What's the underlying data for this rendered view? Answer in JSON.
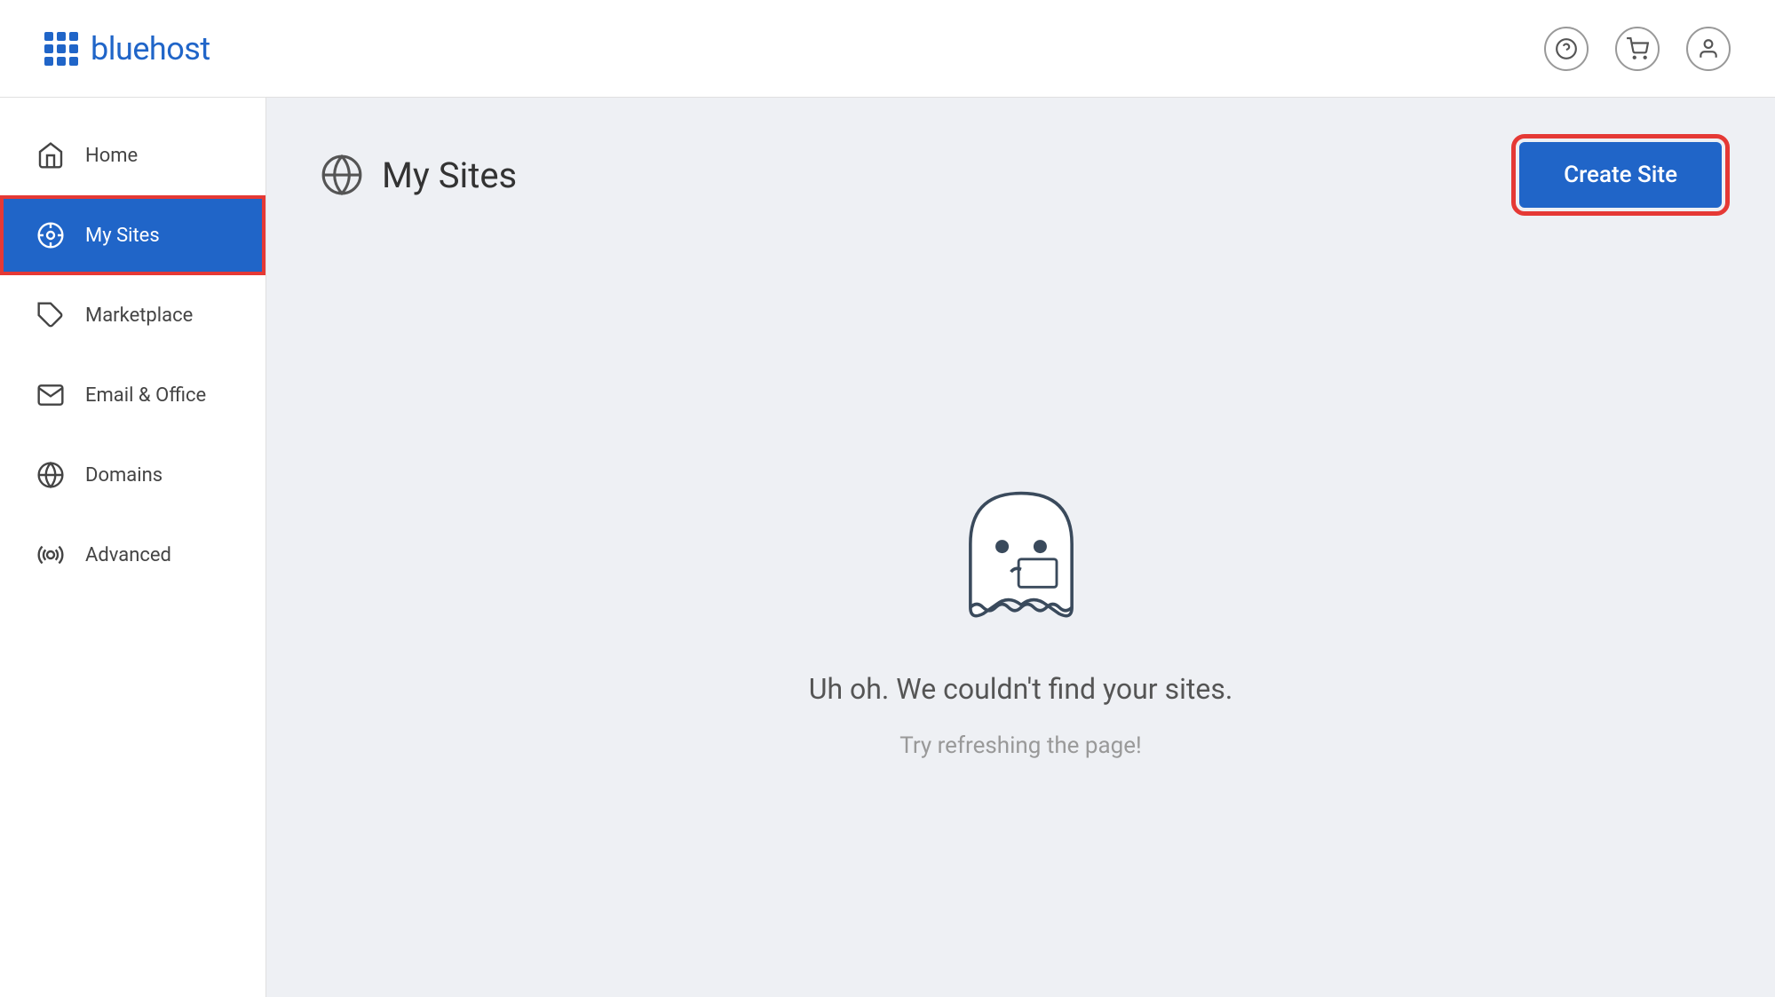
{
  "header": {
    "logo_text": "bluehost",
    "icons": {
      "help": "?",
      "cart": "🛒",
      "user": "👤"
    }
  },
  "sidebar": {
    "items": [
      {
        "id": "home",
        "label": "Home",
        "active": false
      },
      {
        "id": "my-sites",
        "label": "My Sites",
        "active": true
      },
      {
        "id": "marketplace",
        "label": "Marketplace",
        "active": false
      },
      {
        "id": "email-office",
        "label": "Email & Office",
        "active": false
      },
      {
        "id": "domains",
        "label": "Domains",
        "active": false
      },
      {
        "id": "advanced",
        "label": "Advanced",
        "active": false
      }
    ]
  },
  "content": {
    "page_title": "My Sites",
    "create_button": "Create Site",
    "empty_state": {
      "title": "Uh oh. We couldn't find your sites.",
      "subtitle": "Try refreshing the page!"
    }
  }
}
